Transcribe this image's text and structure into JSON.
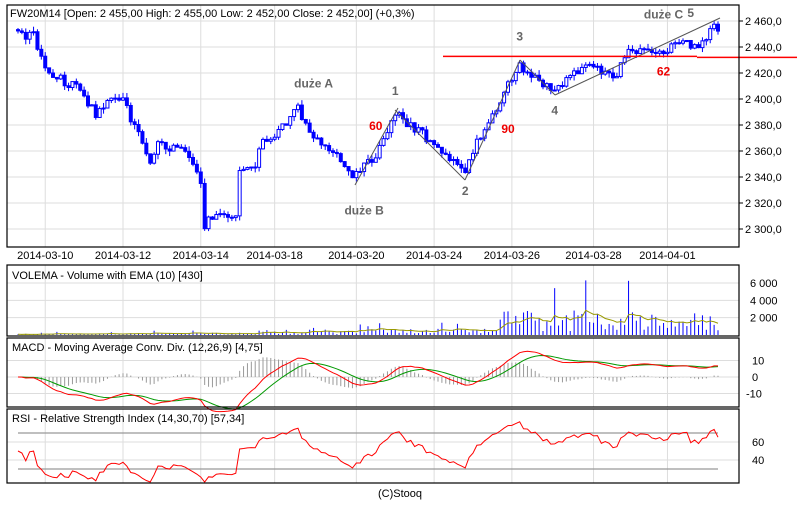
{
  "chart_data": {
    "type": "candlestick",
    "title": "FW20M14 [Open: 2 455,00  High: 2 455,00  Low: 2 452,00  Close: 2 452,00] (+0,3%)",
    "bars": 181,
    "price_path": [
      [
        0,
        2449
      ],
      [
        4,
        2449
      ],
      [
        7,
        2422
      ],
      [
        16,
        2407
      ],
      [
        20,
        2388
      ],
      [
        25,
        2403
      ],
      [
        27,
        2399
      ],
      [
        34,
        2353
      ],
      [
        36,
        2365
      ],
      [
        43,
        2361
      ],
      [
        47,
        2334
      ],
      [
        48,
        2303
      ],
      [
        50,
        2311
      ],
      [
        56,
        2311
      ],
      [
        57,
        2342
      ],
      [
        61,
        2349
      ],
      [
        63,
        2368
      ],
      [
        67,
        2376
      ],
      [
        72,
        2392
      ],
      [
        77,
        2368
      ],
      [
        83,
        2353
      ],
      [
        86,
        2338
      ],
      [
        92,
        2357
      ],
      [
        97,
        2388
      ],
      [
        103,
        2376
      ],
      [
        110,
        2357
      ],
      [
        115,
        2342
      ],
      [
        117,
        2361
      ],
      [
        122,
        2388
      ],
      [
        129,
        2426
      ],
      [
        135,
        2411
      ],
      [
        139,
        2407
      ],
      [
        142,
        2418
      ],
      [
        147,
        2426
      ],
      [
        153,
        2415
      ],
      [
        157,
        2438
      ],
      [
        165,
        2434
      ],
      [
        169,
        2442
      ],
      [
        176,
        2442
      ],
      [
        179,
        2456
      ],
      [
        180,
        2452
      ]
    ],
    "x_ticks": [
      {
        "bar": 7,
        "label": "2014-03-10"
      },
      {
        "bar": 27,
        "label": "2014-03-12"
      },
      {
        "bar": 47,
        "label": "2014-03-14"
      },
      {
        "bar": 66,
        "label": "2014-03-18"
      },
      {
        "bar": 87,
        "label": "2014-03-20"
      },
      {
        "bar": 107,
        "label": "2014-03-24"
      },
      {
        "bar": 127,
        "label": "2014-03-26"
      },
      {
        "bar": 148,
        "label": "2014-03-28"
      },
      {
        "bar": 167,
        "label": "2014-04-01"
      }
    ],
    "y_ticks": [
      {
        "value": 2460,
        "label": "2 460,0"
      },
      {
        "value": 2440,
        "label": "2 440,0"
      },
      {
        "value": 2420,
        "label": "2 420,0"
      },
      {
        "value": 2400,
        "label": "2 400,0"
      },
      {
        "value": 2380,
        "label": "2 380,0"
      },
      {
        "value": 2360,
        "label": "2 360,0"
      },
      {
        "value": 2340,
        "label": "2 340,0"
      },
      {
        "value": 2320,
        "label": "2 320,0"
      },
      {
        "value": 2300,
        "label": "2 300,0"
      }
    ],
    "ylim": [
      2288,
      2474
    ],
    "annotations": {
      "wave_a": {
        "text": "duże A",
        "bar": 76,
        "price": 2409,
        "color": "gray"
      },
      "wave_b": {
        "text": "duże B",
        "bar": 89,
        "price": 2311,
        "color": "gray"
      },
      "wave_c": {
        "text": "duże C",
        "bar": 166,
        "price": 2462,
        "color": "gray"
      },
      "w1": {
        "text": "1",
        "bar": 97,
        "price": 2403,
        "color": "gray"
      },
      "w2": {
        "text": "2",
        "bar": 115,
        "price": 2326,
        "color": "gray"
      },
      "w3": {
        "text": "3",
        "bar": 129,
        "price": 2445,
        "color": "gray"
      },
      "w4": {
        "text": "4",
        "bar": 138,
        "price": 2388,
        "color": "gray"
      },
      "w5": {
        "text": "5",
        "bar": 173,
        "price": 2463,
        "color": "gray"
      },
      "f60": {
        "text": "60",
        "bar": 92,
        "price": 2376,
        "color": "red"
      },
      "f90": {
        "text": "90",
        "bar": 126,
        "price": 2374,
        "color": "red"
      },
      "f62": {
        "text": "62",
        "bar": 166,
        "price": 2418,
        "color": "red"
      }
    },
    "resistance_level": 2432,
    "volume": {
      "title": "VOLEMA - Volume with EMA (10) [430]",
      "levels": [
        [
          0,
          80
        ],
        [
          60,
          150
        ],
        [
          62,
          300
        ],
        [
          120,
          400
        ],
        [
          124,
          1500
        ],
        [
          180,
          1500
        ]
      ],
      "y_ticks": [
        {
          "value": 6000,
          "label": "6 000"
        },
        {
          "value": 4000,
          "label": "4 000"
        },
        {
          "value": 2000,
          "label": "2 000"
        }
      ],
      "ylim": [
        0,
        6000
      ],
      "ema_period": 10
    },
    "macd": {
      "title": "MACD - Moving Average Conv. Div. (12,26,9) [4,75]",
      "params": [
        12,
        26,
        9
      ],
      "y_ticks": [
        {
          "value": 10,
          "label": "10"
        },
        {
          "value": 0,
          "label": "0"
        },
        {
          "value": -10,
          "label": "-10"
        }
      ]
    },
    "rsi": {
      "title": "RSI - Relative Strength Index (14,30,70) [57,34]",
      "period": 14,
      "bands": [
        30,
        70
      ],
      "y_ticks": [
        {
          "value": 60,
          "label": "60"
        },
        {
          "value": 40,
          "label": "40"
        }
      ]
    },
    "colors": {
      "candle": "#0000ff",
      "macd": "#ff0000",
      "signal": "#009900",
      "hist": "#999999",
      "ema": "#999900",
      "rsi": "#ff0000",
      "level": "#ff0000",
      "grid": "#dddddd"
    }
  },
  "footer": "(C)Stooq"
}
